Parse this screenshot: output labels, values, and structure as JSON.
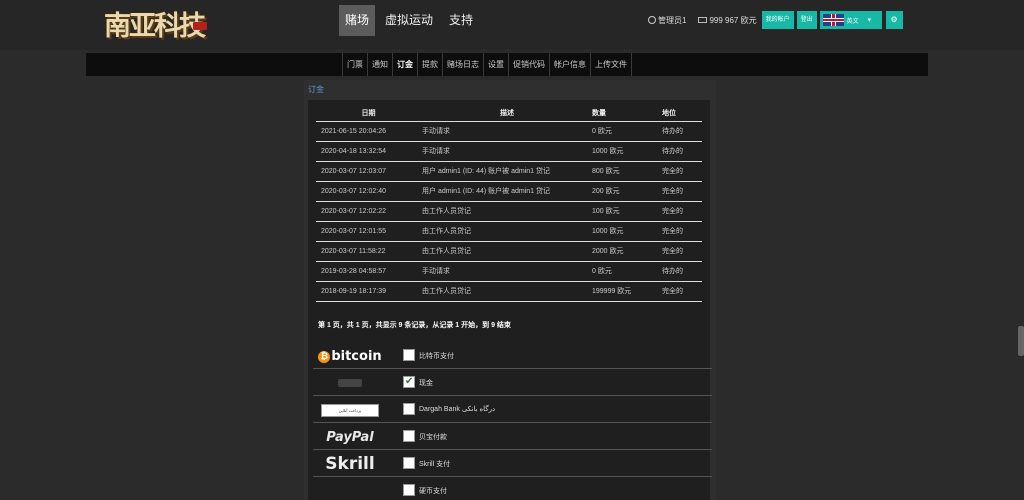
{
  "brand": {
    "logo_text": "南亚科技"
  },
  "nav": {
    "items": [
      "赌场",
      "虚拟运动",
      "支持"
    ],
    "active_index": 0
  },
  "user": {
    "name": "管理员1",
    "balance": "999 967 欧元",
    "my_account_label": "我的帐户",
    "logout_label": "登出",
    "language": "英文"
  },
  "subnav": {
    "items": [
      "门票",
      "通知",
      "订金",
      "提款",
      "赌场日志",
      "设置",
      "促销代码",
      "帐户信息",
      "上传文件"
    ],
    "active_index": 2
  },
  "breadcrumb": "订金",
  "orders": {
    "headers": {
      "date": "日期",
      "description": "描述",
      "amount": "数量",
      "status": "地位"
    },
    "rows": [
      {
        "date": "2021-06-15 20:04:26",
        "description": "手动请求",
        "amount": "0 欧元",
        "status": "待办的"
      },
      {
        "date": "2020-04-18 13:32:54",
        "description": "手动请求",
        "amount": "1000 欧元",
        "status": "待办的"
      },
      {
        "date": "2020-03-07 12:03:07",
        "description": "用户 admin1 (ID: 44) 账户被 admin1 贷记",
        "amount": "800 欧元",
        "status": "完全的"
      },
      {
        "date": "2020-03-07 12:02:40",
        "description": "用户 admin1 (ID: 44) 账户被 admin1 贷记",
        "amount": "200 欧元",
        "status": "完全的"
      },
      {
        "date": "2020-03-07 12:02:22",
        "description": "由工作人员贷记",
        "amount": "100 欧元",
        "status": "完全的"
      },
      {
        "date": "2020-03-07 12:01:55",
        "description": "由工作人员贷记",
        "amount": "1000 欧元",
        "status": "完全的"
      },
      {
        "date": "2020-03-07 11:58:22",
        "description": "由工作人员贷记",
        "amount": "2000 欧元",
        "status": "完全的"
      },
      {
        "date": "2019-03-28 04:58:57",
        "description": "手动请求",
        "amount": "0 欧元",
        "status": "待办的"
      },
      {
        "date": "2018-09-19 18:17:39",
        "description": "由工作人员贷记",
        "amount": "199999 欧元",
        "status": "完全的"
      }
    ],
    "pagination": "第 1 页，共 1 页，共显示 9 条记录，从记录 1 开始，到 9 结束"
  },
  "payments": [
    {
      "logo": "bitcoin",
      "label": "比特币支付",
      "checked": false
    },
    {
      "logo": "cash",
      "label": "现金",
      "checked": true
    },
    {
      "logo": "dargah-bank",
      "label": "Dargah Bank درگاه بانکی",
      "checked": false
    },
    {
      "logo": "PayPal",
      "label": "贝宝付款",
      "checked": false
    },
    {
      "logo": "Skrill",
      "label": "Skrill 支付",
      "checked": false
    },
    {
      "logo": "",
      "label": "硬币支付",
      "checked": false
    }
  ],
  "colors": {
    "accent": "#17b9a6",
    "link": "#5b9bd5",
    "bg": "#2b2b2b",
    "panel": "#1f1f1f"
  }
}
